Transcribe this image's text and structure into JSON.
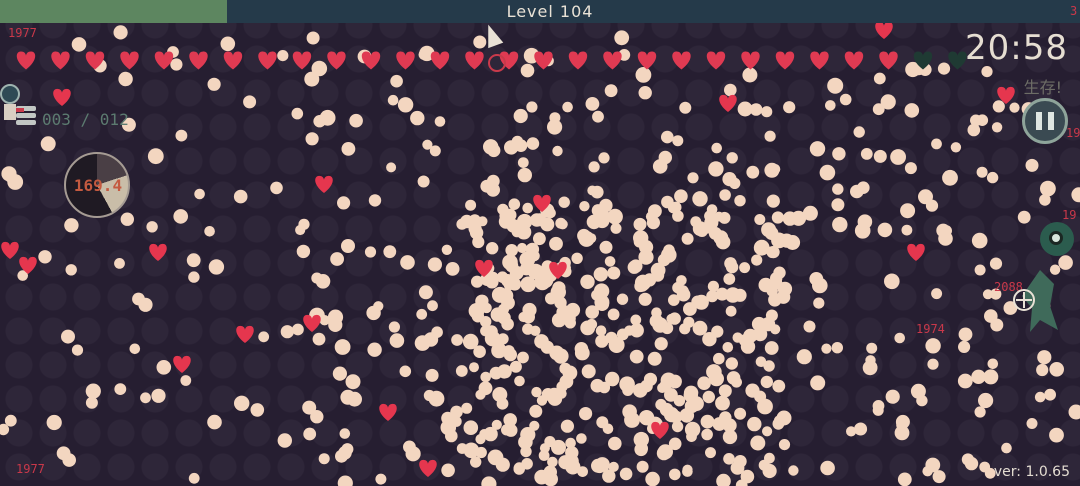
{
  "hud": {
    "level_label": "Level 104",
    "xp_fraction": 0.21,
    "timer": "20:58",
    "survive_label": "生存!",
    "ammo_counter": "003 / 012",
    "cooldown_value": "169.4",
    "version": "ver: 1.0.65"
  },
  "life": {
    "hearts_filled": 26,
    "hearts_total": 28,
    "filled_color": "#e03a52",
    "empty_color": "#1f3a33"
  },
  "damage_numbers": [
    "1977",
    "1977",
    "1974",
    "2088",
    "19",
    "3",
    "19"
  ],
  "colors": {
    "background": "#261e31",
    "bullet": "#f3d6c0",
    "heart": "#e5364e",
    "xp_bar": "#253a4a",
    "xp_fill": "#5d8660"
  },
  "icons": {
    "pause": "pause-icon",
    "heart": "heart-icon",
    "ammo": "ammo-icon",
    "enemy": "eyeball-enemy-icon",
    "cursor": "aim-cursor-icon"
  }
}
